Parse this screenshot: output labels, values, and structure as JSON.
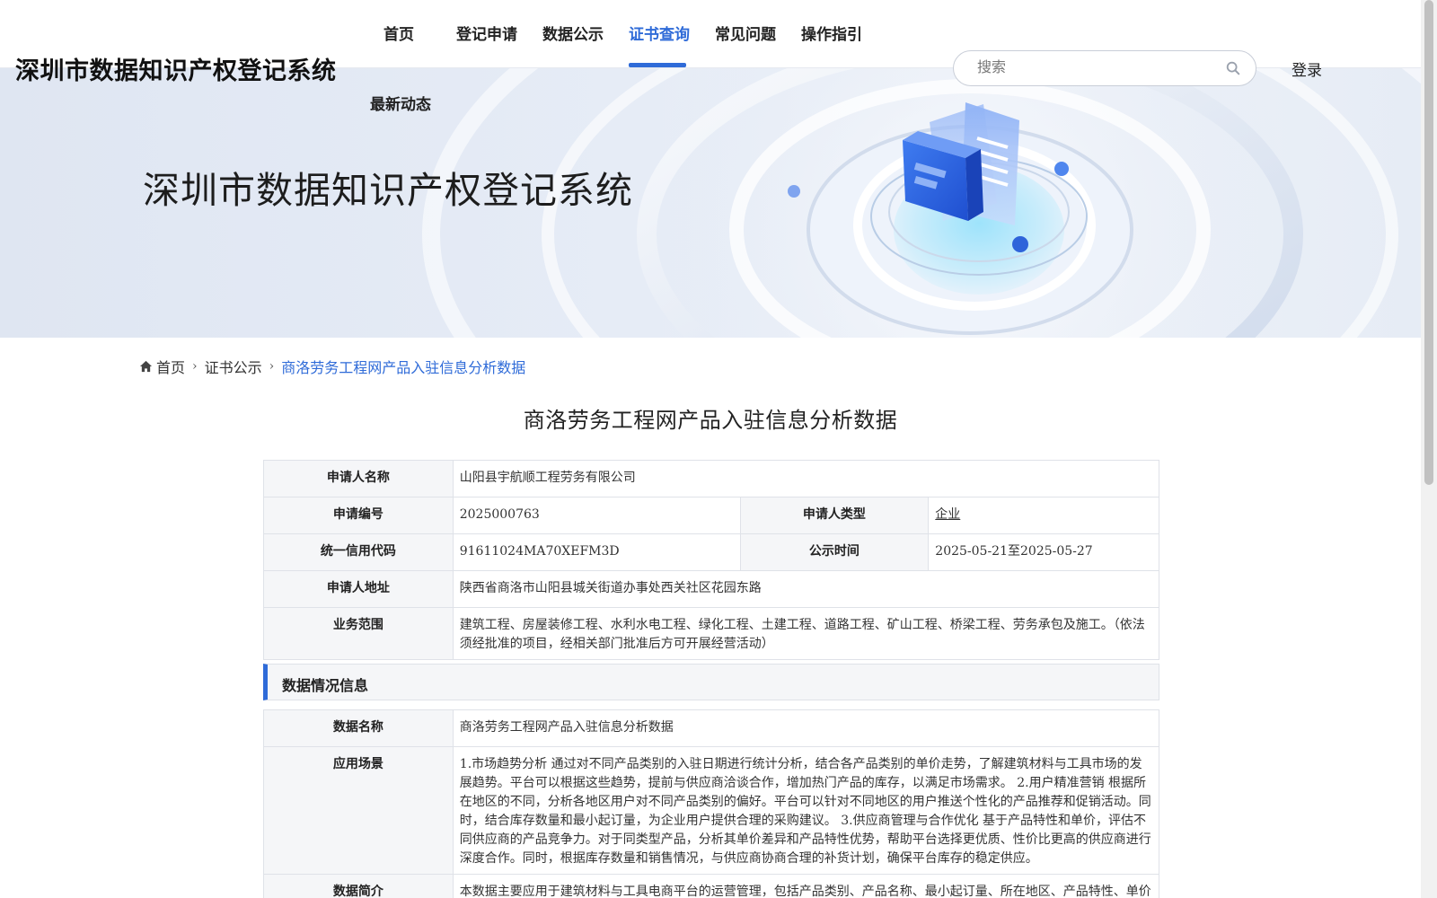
{
  "header": {
    "site_title": "深圳市数据知识产权登记系统",
    "nav": [
      {
        "label": "首页"
      },
      {
        "label": "登记申请"
      },
      {
        "label": "数据公示"
      },
      {
        "label": "证书查询",
        "active": true
      },
      {
        "label": "常见问题"
      },
      {
        "label": "操作指引"
      },
      {
        "label": "最新动态"
      }
    ],
    "search": {
      "placeholder": "搜索",
      "icon": "search-icon"
    },
    "login_label": "登录"
  },
  "banner": {
    "title": "深圳市数据知识产权登记系统"
  },
  "breadcrumb": {
    "home_icon": "home-icon",
    "items": [
      "首页",
      "证书公示",
      "商洛劳务工程网产品入驻信息分析数据"
    ]
  },
  "page_title": "商洛劳务工程网产品入驻信息分析数据",
  "applicant": {
    "name_label": "申请人名称",
    "name_value": "山阳县宇航顺工程劳务有限公司",
    "number_label": "申请编号",
    "number_value": "2025000763",
    "type_label": "申请人类型",
    "type_value": "企业",
    "credit_label": "统一信用代码",
    "credit_value": "91611024MA70XEFM3D",
    "publish_label": "公示时间",
    "publish_value": "2025-05-21至2025-05-27",
    "address_label": "申请人地址",
    "address_value": "陕西省商洛市山阳县城关街道办事处西关社区花园东路",
    "scope_label": "业务范围",
    "scope_value": "建筑工程、房屋装修工程、水利水电工程、绿化工程、土建工程、道路工程、矿山工程、桥梁工程、劳务承包及施工。（依法须经批准的项目，经相关部门批准后方可开展经营活动）"
  },
  "data_section": {
    "title": "数据情况信息",
    "name_label": "数据名称",
    "name_value": "商洛劳务工程网产品入驻信息分析数据",
    "scenario_label": "应用场景",
    "scenario_value": "1.市场趋势分析 通过对不同产品类别的入驻日期进行统计分析，结合各产品类别的单价走势，了解建筑材料与工具市场的发展趋势。平台可以根据这些趋势，提前与供应商洽谈合作，增加热门产品的库存，以满足市场需求。 2.用户精准营销 根据所在地区的不同，分析各地区用户对不同产品类别的偏好。平台可以针对不同地区的用户推送个性化的产品推荐和促销活动。同时，结合库存数量和最小起订量，为企业用户提供合理的采购建议。 3.供应商管理与合作优化 基于产品特性和单价，评估不同供应商的产品竞争力。对于同类型产品，分析其单价差异和产品特性优势，帮助平台选择更优质、性价比更高的供应商进行深度合作。同时，根据库存数量和销售情况，与供应商协商合理的补货计划，确保平台库存的稳定供应。",
    "intro_label": "数据简介",
    "intro_value": "本数据主要应用于建筑材料与工具电商平台的运营管理，包括产品类别、产品名称、最小起订量、所在地区、产品特性、单价等方面。通过对数据的分析和挖掘，为平台的决策提供支持，提升平台的运营效率和服务质量。"
  },
  "colors": {
    "accent": "#2f6bd8",
    "label_bg": "#f5f6f8",
    "border": "#dfe2e8"
  }
}
